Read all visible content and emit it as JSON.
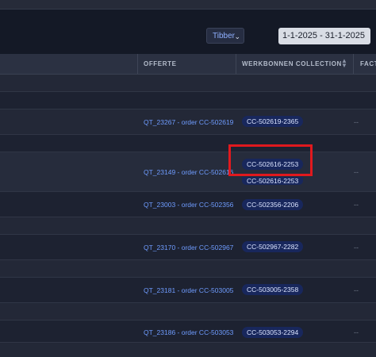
{
  "toolbar": {
    "company_select": "Tibber",
    "date_range": "1-1-2025 - 31-1-2025"
  },
  "table": {
    "columns": {
      "offerte": "OFFERTE",
      "werkbonnen": "WERKBONNEN COLLECTION",
      "factuur": "FACT"
    },
    "rows": [
      {
        "offerte": "QT_23267 - order CC-502619",
        "badge": "CC-502619-2365",
        "factuur": "--"
      },
      {
        "offerte": "QT_23149 - order CC-502616",
        "badge": "CC-502616-2253",
        "badge2": "CC-502616-2253",
        "factuur": "--"
      },
      {
        "offerte": "QT_23003 - order CC-502356",
        "badge": "CC-502356-2206",
        "factuur": "--"
      },
      {
        "offerte": "QT_23170 - order CC-502967",
        "badge": "CC-502967-2282",
        "factuur": "--"
      },
      {
        "offerte": "QT_23181 - order CC-503005",
        "badge": "CC-503005-2358",
        "factuur": "--"
      },
      {
        "offerte": "QT_23186 - order CC-503053",
        "badge": "CC-503053-2294",
        "factuur": "--"
      }
    ]
  },
  "colors": {
    "accent_link": "#6f9cff",
    "badge_bg": "#18275c",
    "highlight": "#e0191e"
  }
}
